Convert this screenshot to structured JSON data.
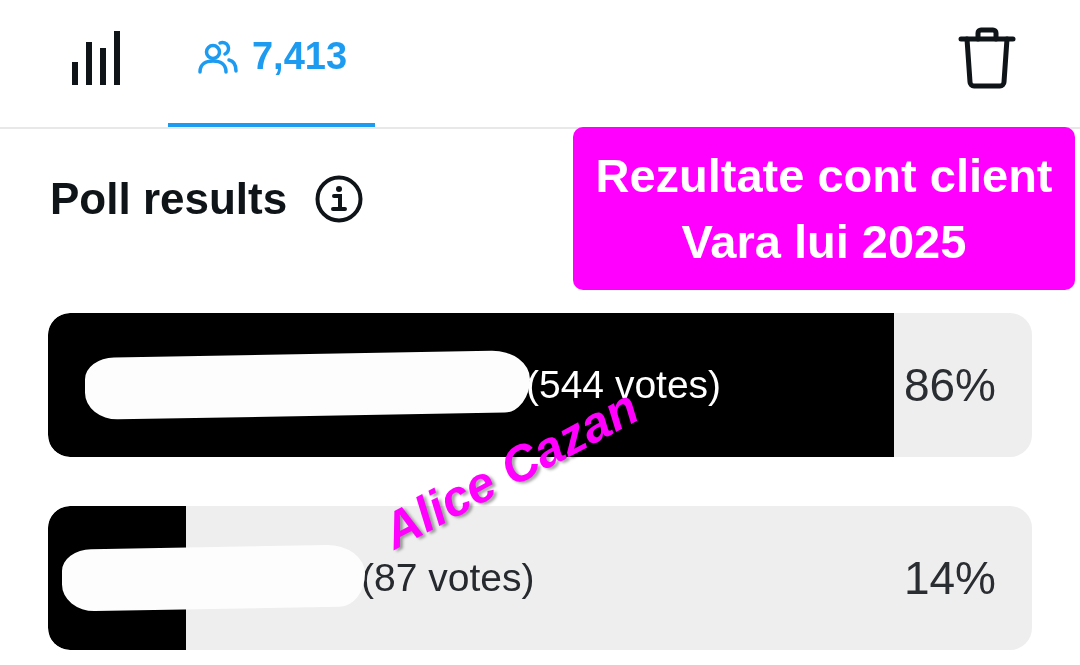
{
  "tabs": [
    {
      "kind": "chart",
      "selected": false
    },
    {
      "kind": "voters",
      "label": "7,413",
      "selected": true
    }
  ],
  "heading": "Poll results",
  "caption": {
    "lines": [
      "Rezultate cont client",
      "Vara lui 2025"
    ]
  },
  "options": [
    {
      "votes": "(544 votes)",
      "percent": "86%",
      "level": 0.86
    },
    {
      "votes": "(87 votes)",
      "percent": "14%",
      "level": 0.14
    }
  ],
  "signature": "Alice Cazan"
}
